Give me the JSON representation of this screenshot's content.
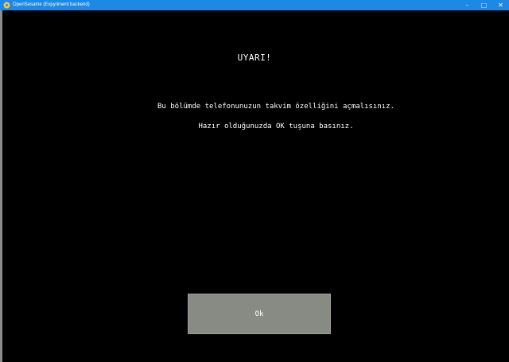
{
  "window": {
    "title": "OpenSesame (Expyriment backend)",
    "minimize_glyph": "–",
    "maximize_glyph": "□",
    "close_glyph": "✕",
    "icon": "opensesame-app-icon"
  },
  "content": {
    "heading": "UYARI!",
    "line1": "Bu bölümde telefonunuzun takvim özelliğini açmalısınız.",
    "line2": "Hazır olduğunuzda OK tuşuna basınız."
  },
  "ok_button": {
    "label": "Ok"
  },
  "colors": {
    "titlebar": "#1e88e5",
    "background": "#000000",
    "button": "#888a84",
    "text": "#ffffff"
  }
}
